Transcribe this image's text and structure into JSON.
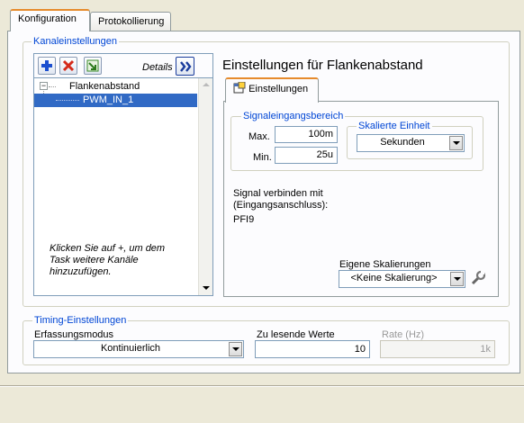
{
  "tabs": [
    {
      "label": "Konfiguration",
      "active": true
    },
    {
      "label": "Protokollierung",
      "active": false
    }
  ],
  "channel_settings": {
    "legend": "Kanaleinstellungen",
    "details_label": "Details",
    "tree": {
      "root": "Flankenabstand",
      "child": "PWM_IN_1"
    },
    "hint": "Klicken Sie auf +, um dem Task weitere Kanäle hinzuzufügen.",
    "panel_title": "Einstellungen für Flankenabstand",
    "inner_tab": "Einstellungen",
    "signal_range": {
      "legend": "Signaleingangsbereich",
      "max_label": "Max.",
      "max_value": "100m",
      "min_label": "Min.",
      "min_value": "25u"
    },
    "scaled_unit": {
      "legend": "Skalierte Einheit",
      "value": "Sekunden"
    },
    "connect_label": "Signal verbinden mit (Eingangsanschluss):",
    "connect_value": "PFI9",
    "custom_scaling": {
      "label": "Eigene Skalierungen",
      "value": "<Keine Skalierung>"
    }
  },
  "timing": {
    "legend": "Timing-Einstellungen",
    "mode_label": "Erfassungsmodus",
    "mode_value": "Kontinuierlich",
    "samples_label": "Zu lesende Werte",
    "samples_value": "10",
    "rate_label": "Rate (Hz)",
    "rate_value": "1k"
  },
  "icons": [
    "add-icon",
    "remove-icon",
    "move-icon",
    "double-chevron-right-icon",
    "settings-icon",
    "wrench-icon",
    "chevron-down-icon"
  ],
  "colors": {
    "legend": "#0046d5",
    "selection": "#316ac5",
    "tab_accent": "#e68b2c"
  }
}
